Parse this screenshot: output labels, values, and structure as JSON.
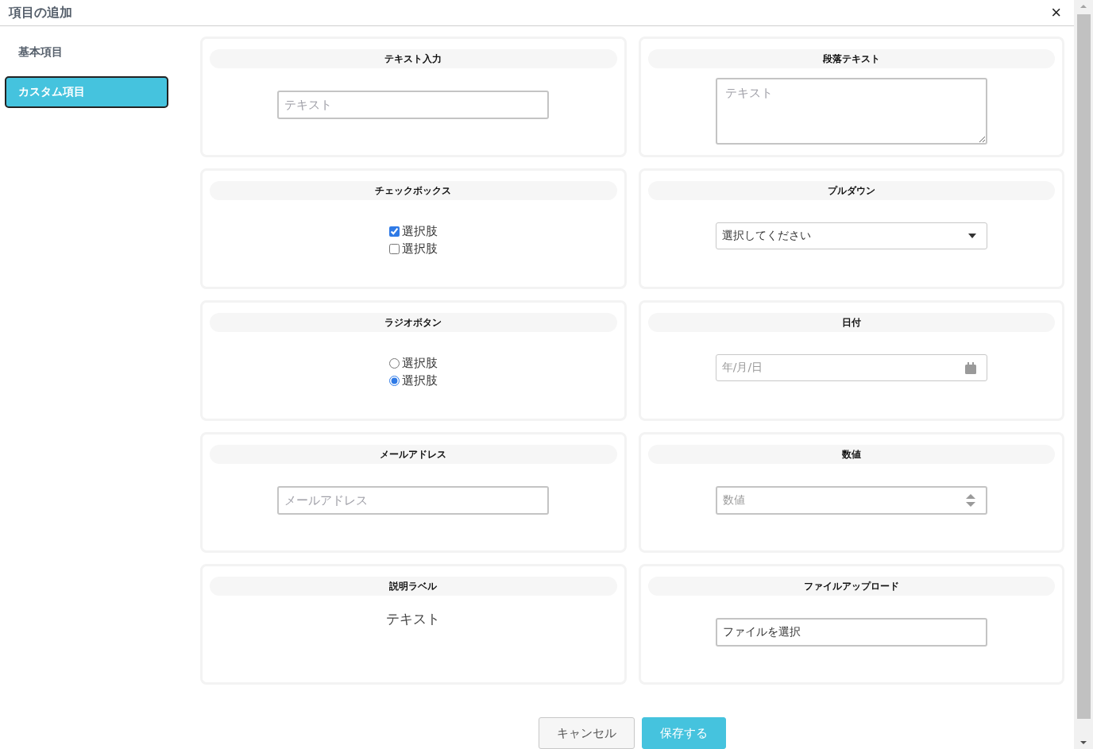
{
  "dialog": {
    "title": "項目の追加",
    "close": "×"
  },
  "sidebar": {
    "items": [
      {
        "label": "基本項目",
        "selected": false
      },
      {
        "label": "カスタム項目",
        "selected": true
      }
    ]
  },
  "fields": [
    {
      "kind": "text",
      "title": "テキスト入力",
      "placeholder": "テキスト"
    },
    {
      "kind": "textarea",
      "title": "段落テキスト",
      "placeholder": "テキスト"
    },
    {
      "kind": "checkbox",
      "title": "チェックボックス",
      "options": [
        {
          "label": "選択肢",
          "checked": true
        },
        {
          "label": "選択肢",
          "checked": false
        }
      ]
    },
    {
      "kind": "select",
      "title": "プルダウン",
      "value": "選択してください"
    },
    {
      "kind": "radio",
      "title": "ラジオボタン",
      "options": [
        {
          "label": "選択肢",
          "selected": false
        },
        {
          "label": "選択肢",
          "selected": true
        }
      ]
    },
    {
      "kind": "date",
      "title": "日付",
      "placeholder": "年/月/日"
    },
    {
      "kind": "email",
      "title": "メールアドレス",
      "placeholder": "メールアドレス"
    },
    {
      "kind": "number",
      "title": "数値",
      "placeholder": "数値"
    },
    {
      "kind": "label",
      "title": "説明ラベル",
      "text": "テキスト"
    },
    {
      "kind": "file",
      "title": "ファイルアップロード",
      "value": "ファイルを選択"
    }
  ],
  "buttons": [
    {
      "label": "キャンセル",
      "kind": "secondary"
    },
    {
      "label": "保存する",
      "kind": "primary"
    }
  ]
}
